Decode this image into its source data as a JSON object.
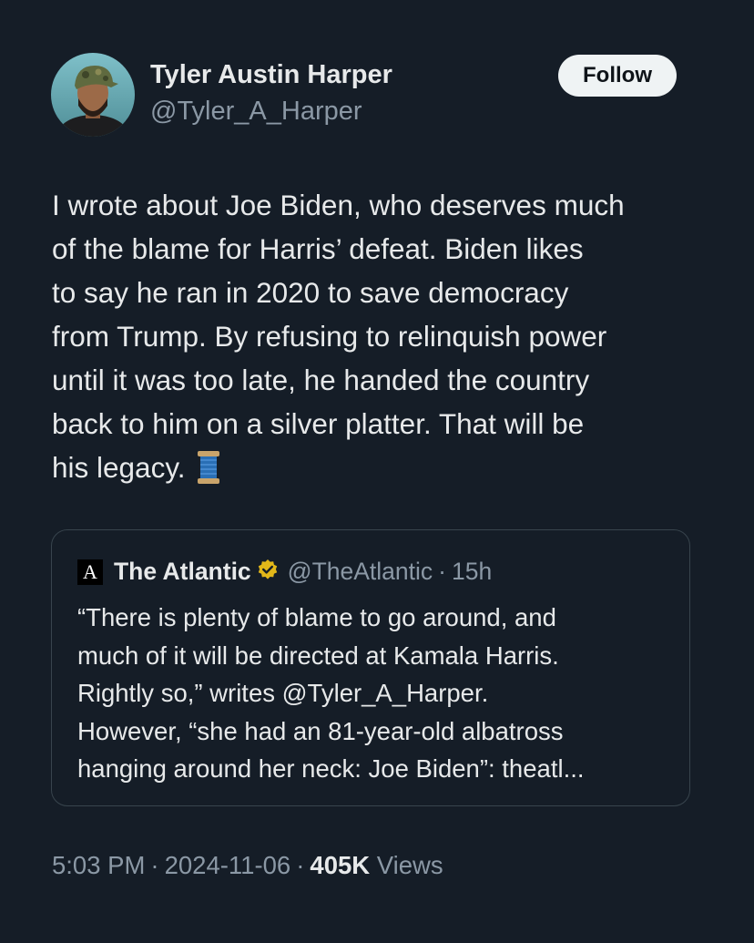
{
  "author": {
    "display_name": "Tyler Austin Harper",
    "handle": "@Tyler_A_Harper",
    "avatar_icon": "profile-photo"
  },
  "follow_label": "Follow",
  "tweet": {
    "lines": [
      "I wrote about Joe Biden, who deserves much",
      "of the blame for Harris’ defeat. Biden likes",
      "to say he ran in 2020 to save democracy",
      "from Trump. By refusing to relinquish power",
      "until it was too late, he handed the country",
      "back to him on a silver platter. That will be",
      "his legacy."
    ],
    "emoji_icon": "spool-of-thread-icon"
  },
  "quote": {
    "logo_letter": "A",
    "name": "The Atlantic",
    "verified_icon": "gold-verified-badge-icon",
    "handle": "@TheAtlantic",
    "separator": "·",
    "time": "15h",
    "lines": [
      "“There is plenty of blame to go around, and",
      "much of it will be directed at Kamala Harris.",
      "Rightly so,” writes @Tyler_A_Harper.",
      "However, “she had an 81-year-old albatross",
      "hanging around her neck: Joe Biden”: theatl..."
    ]
  },
  "meta": {
    "time": "5:03 PM",
    "date": "2024-11-06",
    "separator": "·",
    "views_count": "405K",
    "views_label": "Views"
  },
  "colors": {
    "background": "#151d27",
    "text": "#e7e9ea",
    "secondary_text": "#8b98a5",
    "border": "#38444d",
    "follow_button_bg": "#eff3f4",
    "verified_gold": "#e2b719"
  }
}
